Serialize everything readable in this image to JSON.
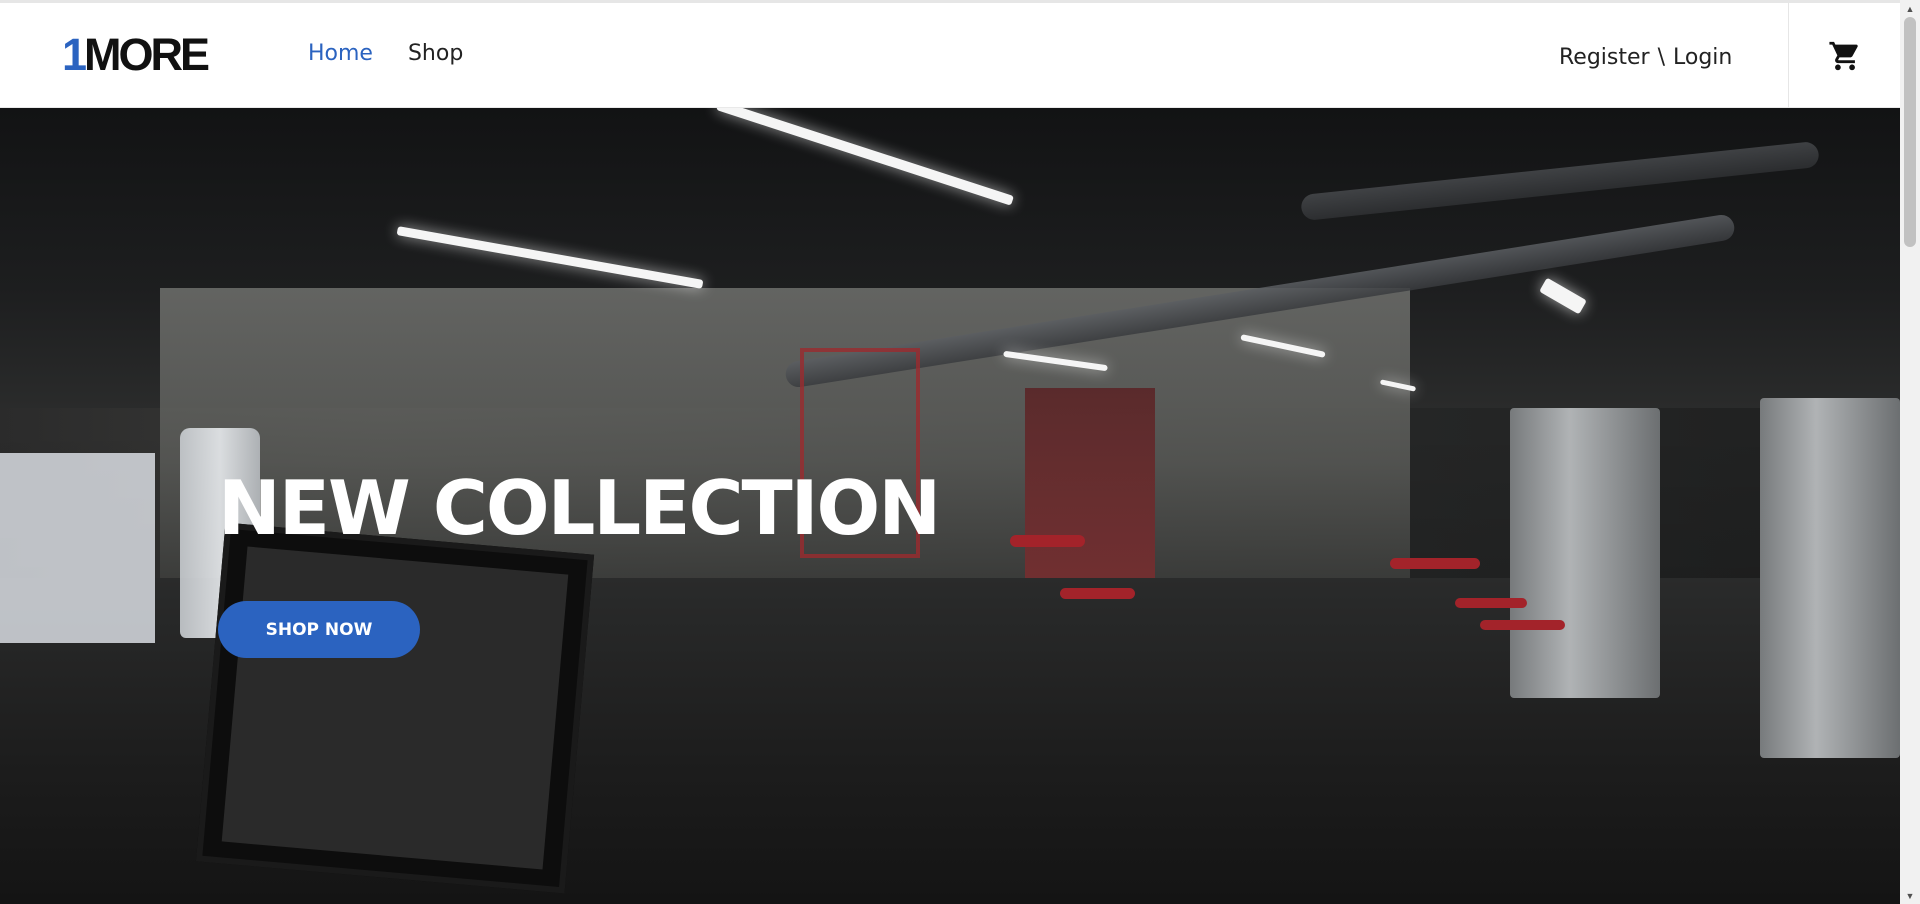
{
  "brand": {
    "logo_prefix": "1",
    "logo_rest": "MORE",
    "accent": "#2b63c0"
  },
  "nav": {
    "items": [
      {
        "label": "Home",
        "active": true
      },
      {
        "label": "Shop",
        "active": false
      }
    ]
  },
  "auth": {
    "register": "Register",
    "separator": "\\",
    "login": "Login"
  },
  "cart": {
    "icon": "cart-icon"
  },
  "hero": {
    "title": "NEW COLLECTION",
    "button": "SHOP NOW",
    "image_description": "dark gym interior"
  },
  "scrollbar": {
    "up_icon": "▲",
    "down_icon": "▼"
  }
}
